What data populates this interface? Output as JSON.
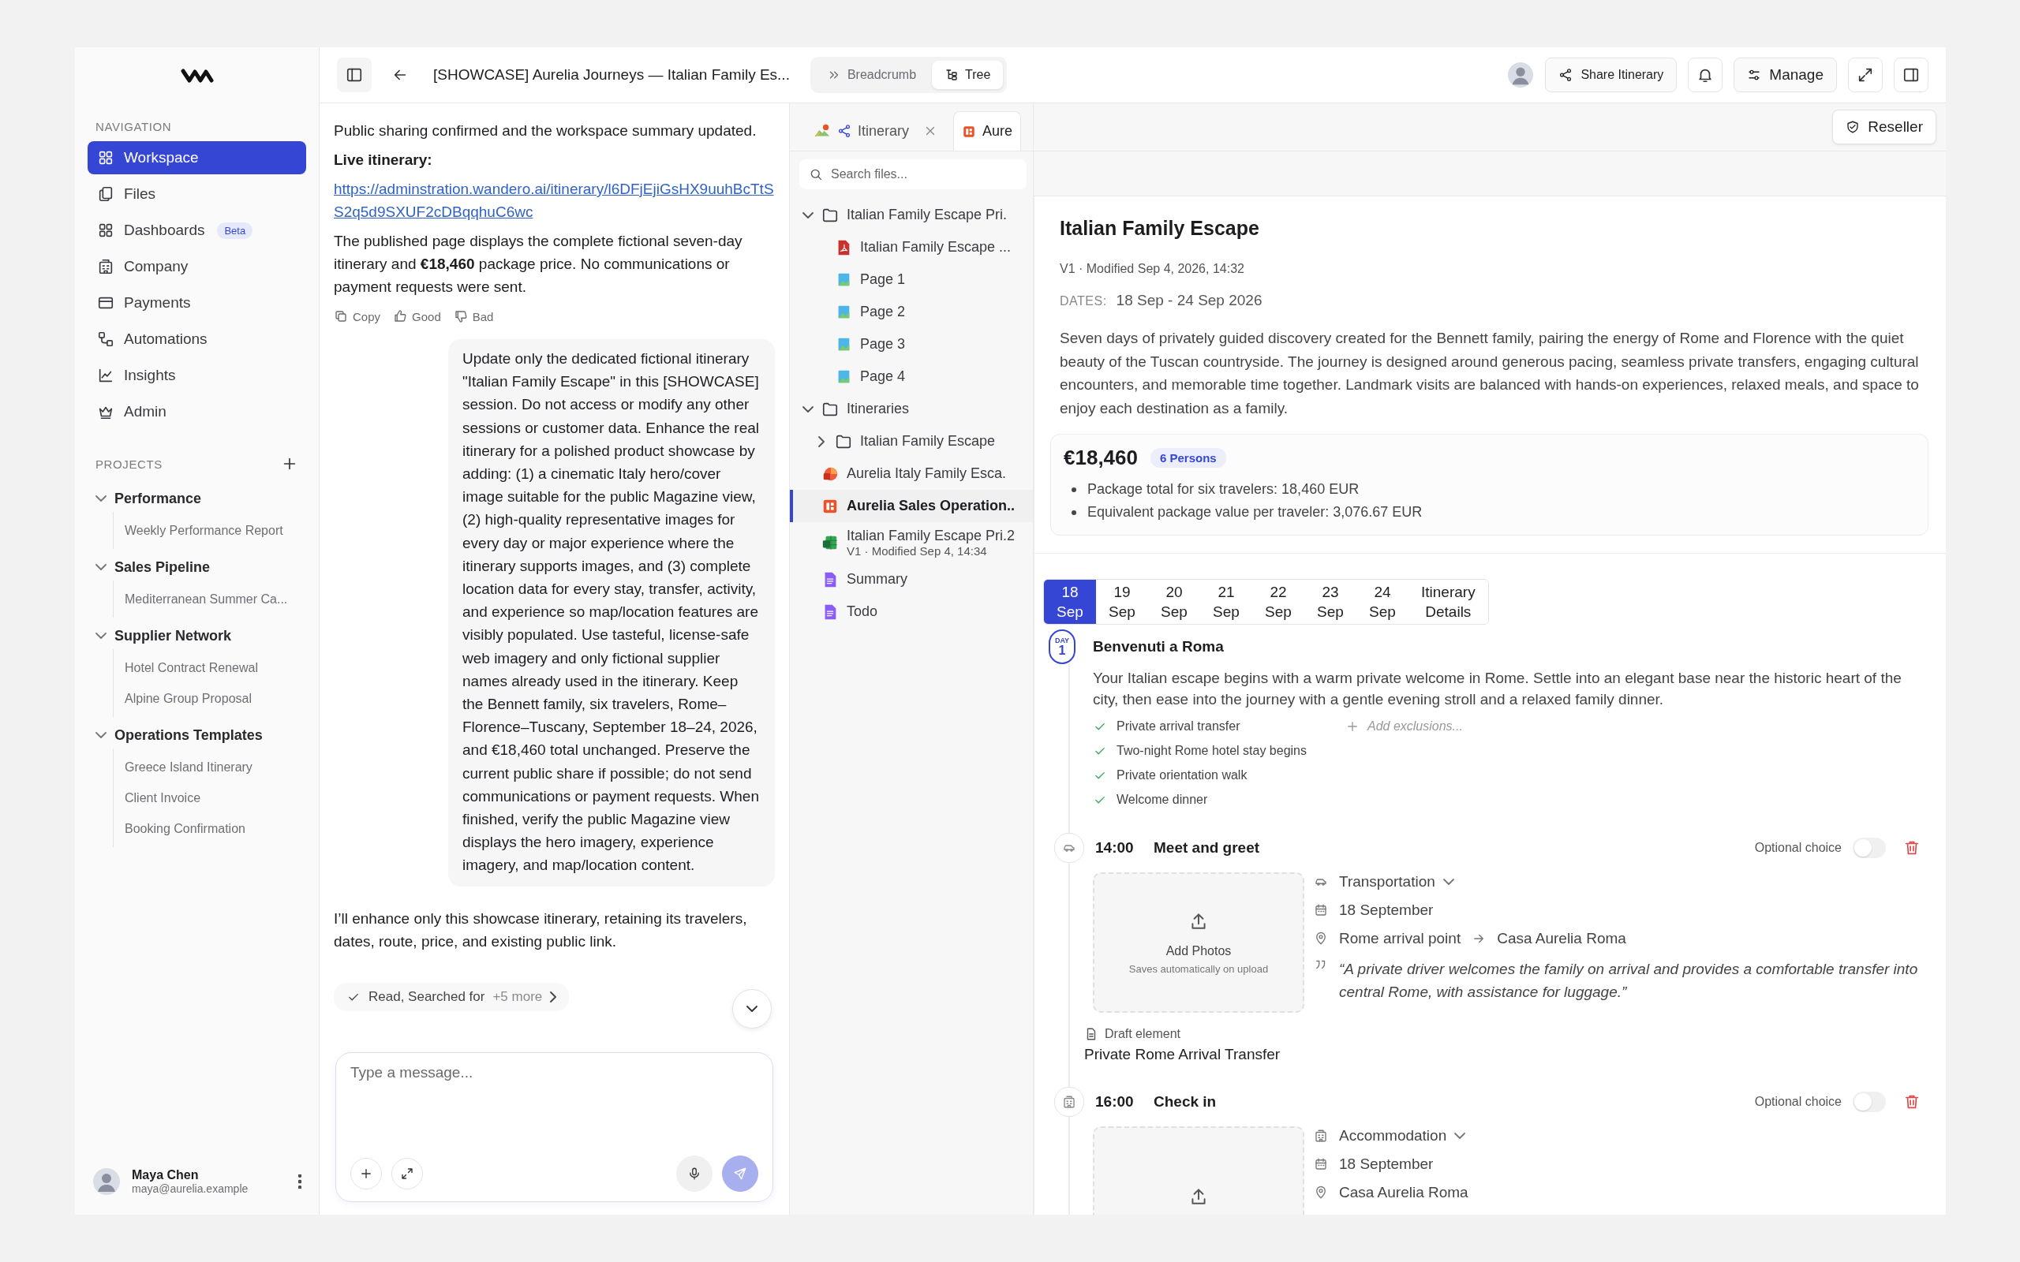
{
  "sidebar": {
    "nav_title": "NAVIGATION",
    "nav": [
      {
        "label": "Workspace",
        "selected": true
      },
      {
        "label": "Files",
        "selected": false
      },
      {
        "label": "Dashboards",
        "selected": false,
        "badge": "Beta"
      },
      {
        "label": "Company",
        "selected": false
      },
      {
        "label": "Payments",
        "selected": false
      },
      {
        "label": "Automations",
        "selected": false
      },
      {
        "label": "Insights",
        "selected": false
      },
      {
        "label": "Admin",
        "selected": false
      }
    ],
    "projects_title": "PROJECTS",
    "projects": [
      {
        "label": "Performance",
        "expanded": true,
        "children": [
          {
            "label": "Weekly Performance Report"
          }
        ]
      },
      {
        "label": "Sales Pipeline",
        "expanded": true,
        "children": [
          {
            "label": "Mediterranean Summer Ca..."
          }
        ]
      },
      {
        "label": "Supplier Network",
        "expanded": true,
        "children": [
          {
            "label": "Hotel Contract Renewal"
          },
          {
            "label": "Alpine Group Proposal"
          }
        ]
      },
      {
        "label": "Operations Templates",
        "expanded": true,
        "children": [
          {
            "label": "Greece Island Itinerary"
          },
          {
            "label": "Client Invoice"
          },
          {
            "label": "Booking Confirmation"
          }
        ]
      }
    ],
    "user": {
      "name": "Maya Chen",
      "email": "maya@aurelia.example"
    }
  },
  "header": {
    "title": "[SHOWCASE] Aurelia Journeys — Italian Family Es...",
    "view_toggle": [
      {
        "label": "Breadcrumb",
        "selected": false
      },
      {
        "label": "Tree",
        "selected": true
      }
    ],
    "share_label": "Share Itinerary",
    "manage_label": "Manage"
  },
  "chat": {
    "messages": [
      {
        "kind": "assistant",
        "blocks": [
          {
            "kind": "text",
            "text": "Public sharing confirmed and the workspace summary updated."
          },
          {
            "kind": "label",
            "text": "Live itinerary:"
          },
          {
            "kind": "link",
            "text": "https://adminstration.wandero.ai/itinerary/l6DFjEjiGsHX9uuhBcTtSS2q5d9SXUF2cDBqqhuC6wc"
          },
          {
            "kind": "text",
            "text": "The published page displays the complete fictional seven-day itinerary and **€18,460** package price. No communications or payment requests were sent."
          }
        ],
        "actions": [
          "Copy",
          "Good",
          "Bad"
        ]
      },
      {
        "kind": "user",
        "text": "Update only the dedicated fictional itinerary \"Italian Family Escape\" in this [SHOWCASE] session. Do not access or modify any other sessions or customer data. Enhance the real itinerary for a polished product showcase by adding: (1) a cinematic Italy hero/cover image suitable for the public Magazine view, (2) high-quality representative images for every day or major experience where the itinerary supports images, and (3) complete location data for every stay, transfer, activity, and experience so map/location features are visibly populated. Use tasteful, license-safe web imagery and only fictional supplier names already used in the itinerary. Keep the Bennett family, six travelers, Rome–Florence–Tuscany, September 18–24, 2026, and €18,460 total unchanged. Preserve the current public share if possible; do not send communications or payment requests. When finished, verify the public Magazine view displays the hero imagery, experience imagery, and map/location content."
      },
      {
        "kind": "assistant",
        "blocks": [
          {
            "kind": "text",
            "text": "I’ll enhance only this showcase itinerary, retaining its travelers, dates, route, price, and existing public link."
          }
        ]
      }
    ],
    "activity": {
      "text": "Read, Searched for",
      "more": "+5 more"
    },
    "input": {
      "placeholder": "Type a message..."
    }
  },
  "files": {
    "tabs": [
      {
        "label": "Itinerary",
        "kind": "itinerary",
        "selected": false
      },
      {
        "label": "Aure",
        "kind": "slides",
        "selected": true
      }
    ],
    "search": {
      "placeholder": "Search files..."
    },
    "tree": [
      {
        "kind": "folder",
        "label": "Italian Family Escape Pri.",
        "expanded": true,
        "selected": false,
        "children": [
          {
            "kind": "pdf",
            "label": "Italian Family Escape ...",
            "selected": false
          },
          {
            "kind": "image",
            "label": "Page 1",
            "selected": false
          },
          {
            "kind": "image",
            "label": "Page 2",
            "selected": false
          },
          {
            "kind": "image",
            "label": "Page 3",
            "selected": false
          },
          {
            "kind": "image",
            "label": "Page 4",
            "selected": false
          }
        ]
      },
      {
        "kind": "folder",
        "label": "Itineraries",
        "expanded": true,
        "selected": false,
        "children": [
          {
            "kind": "folder",
            "label": "Italian Family Escape",
            "expanded": false,
            "selected": false
          }
        ]
      },
      {
        "kind": "presentation",
        "label": "Aurelia Italy Family Esca.",
        "selected": false
      },
      {
        "kind": "slides",
        "label": "Aurelia Sales Operation..",
        "selected": true
      },
      {
        "kind": "spreadsheet",
        "label": "Italian Family Escape Pri.2",
        "subtitle": "V1 · Modified Sep 4, 14:34",
        "selected": false
      },
      {
        "kind": "document",
        "label": "Summary",
        "selected": false
      },
      {
        "kind": "document",
        "label": "Todo",
        "selected": false
      }
    ]
  },
  "document": {
    "reseller_label": "Reseller",
    "title": "Italian Family Escape",
    "meta": "V1 · Modified Sep 4, 2026, 14:32",
    "dates_label": "DATES:",
    "dates": "18 Sep - 24 Sep 2026",
    "description": "Seven days of privately guided discovery created for the Bennett family, pairing the energy of Rome and Florence with the quiet beauty of the Tuscan countryside. The journey is designed around generous pacing, seamless private transfers, engaging cultural encounters, and memorable time together. Landmark visits are balanced with hands-on experiences, relaxed meals, and space to enjoy each destination as a family.",
    "price": "€18,460",
    "persons": "6 Persons",
    "price_notes": [
      "Package total for six travelers: 18,460 EUR",
      "Equivalent package value per traveler: 3,076.67 EUR"
    ],
    "day_tabs": [
      {
        "lines": [
          "18",
          "Sep"
        ],
        "selected": true
      },
      {
        "lines": [
          "19",
          "Sep"
        ],
        "selected": false
      },
      {
        "lines": [
          "20",
          "Sep"
        ],
        "selected": false
      },
      {
        "lines": [
          "21",
          "Sep"
        ],
        "selected": false
      },
      {
        "lines": [
          "22",
          "Sep"
        ],
        "selected": false
      },
      {
        "lines": [
          "23",
          "Sep"
        ],
        "selected": false
      },
      {
        "lines": [
          "24",
          "Sep"
        ],
        "selected": false
      },
      {
        "lines": [
          "Itinerary",
          "Details"
        ],
        "selected": false
      }
    ],
    "day": {
      "badge_label": "DAY",
      "number": "1",
      "title": "Benvenuti a Roma",
      "description": "Your Italian escape begins with a warm private welcome in Rome. Settle into an elegant base near the historic heart of the city, then ease into the journey with a gentle evening stroll and a relaxed family dinner.",
      "inclusions": [
        "Private arrival transfer",
        "Two-night Rome hotel stay begins",
        "Private orientation walk",
        "Welcome dinner"
      ],
      "exclusions_placeholder": "Add exclusions..."
    },
    "elements": [
      {
        "kind": "transfer",
        "time": "14:00",
        "title": "Meet and greet",
        "optional_label": "Optional choice",
        "optional": false,
        "upload": {
          "title": "Add Photos",
          "hint": "Saves automatically on upload"
        },
        "category": "Transportation",
        "date": "18 September",
        "route": {
          "from": "Rome arrival point",
          "to": "Casa Aurelia Roma"
        },
        "quote": "“A private driver welcomes the family on arrival and provides a comfortable transfer into central Rome, with assistance for luggage.”",
        "status": "Draft element",
        "name": "Private Rome Arrival Transfer"
      },
      {
        "kind": "accommodation",
        "time": "16:00",
        "title": "Check in",
        "optional_label": "Optional choice",
        "optional": false,
        "category": "Accommodation",
        "date": "18 September",
        "location": "Casa Aurelia Roma"
      }
    ]
  }
}
